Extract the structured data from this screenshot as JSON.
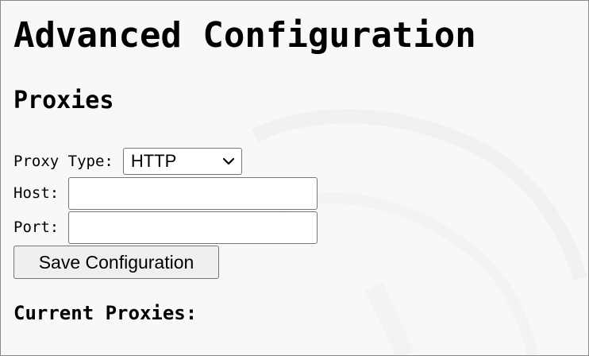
{
  "page": {
    "title": "Advanced Configuration",
    "section_title": "Proxies"
  },
  "form": {
    "proxy_type": {
      "label": "Proxy Type:",
      "selected": "HTTP",
      "icon": "chevron-down-icon"
    },
    "host": {
      "label": "Host:",
      "value": "",
      "placeholder": ""
    },
    "port": {
      "label": "Port:",
      "value": "",
      "placeholder": ""
    },
    "save_label": "Save Configuration"
  },
  "current_proxies": {
    "title": "Current Proxies:"
  },
  "colors": {
    "background": "#f8f8f8",
    "border": "#8a8a8a",
    "button_bg": "#efefef",
    "control_border": "#767676"
  }
}
